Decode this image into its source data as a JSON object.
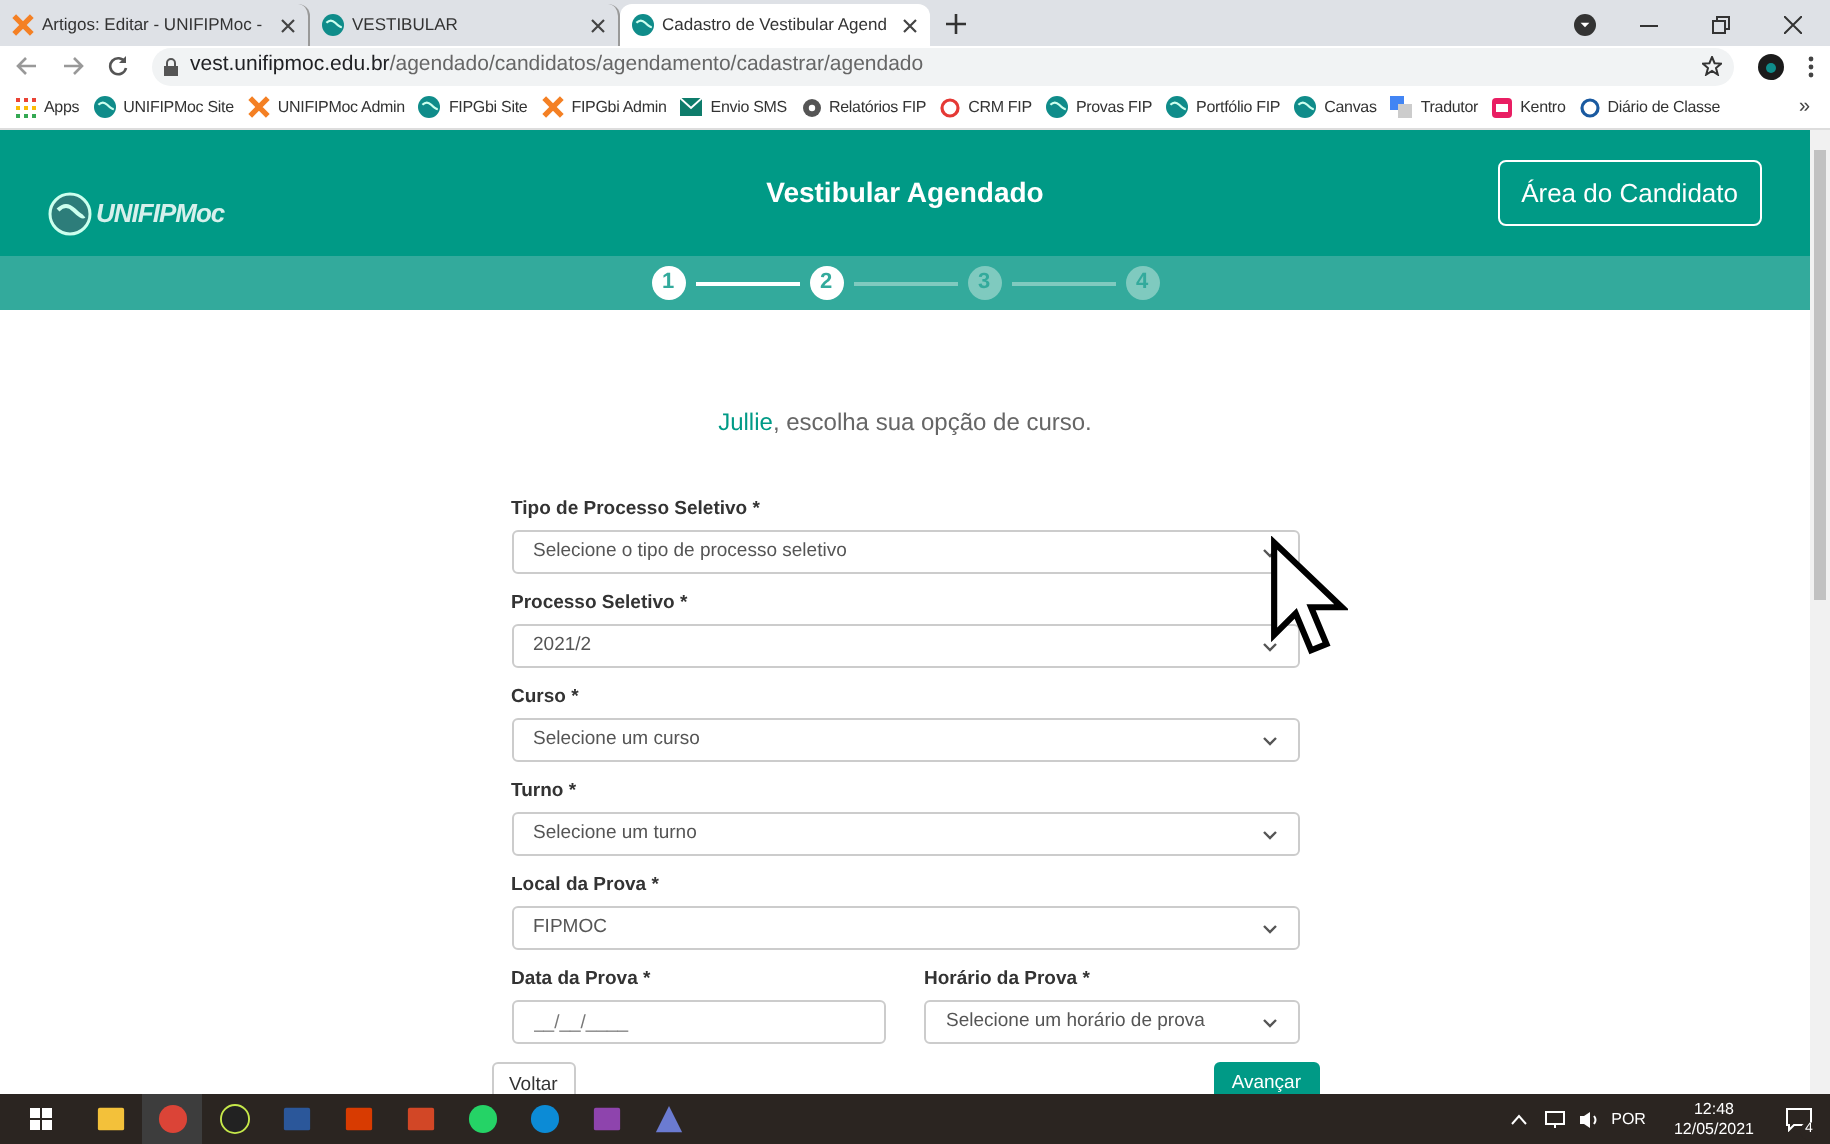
{
  "browser": {
    "tabs": [
      {
        "title": "Artigos: Editar - UNIFIPMoc -",
        "selected": false
      },
      {
        "title": "VESTIBULAR",
        "selected": false
      },
      {
        "title": "Cadastro de Vestibular Agend",
        "selected": true
      }
    ],
    "url_host": "vest.unifipmoc.edu.br",
    "url_path": "/agendado/candidatos/agendamento/cadastrar/agendado",
    "bookmarks": [
      {
        "label": "Apps"
      },
      {
        "label": "UNIFIPMoc Site"
      },
      {
        "label": "UNIFIPMoc Admin"
      },
      {
        "label": "FIPGbi Site"
      },
      {
        "label": "FIPGbi Admin"
      },
      {
        "label": "Envio SMS"
      },
      {
        "label": "Relatórios FIP"
      },
      {
        "label": "CRM FIP"
      },
      {
        "label": "Provas FIP"
      },
      {
        "label": "Portfólio FIP"
      },
      {
        "label": "Canvas"
      },
      {
        "label": "Tradutor"
      },
      {
        "label": "Kentro"
      },
      {
        "label": "Diário de Classe"
      }
    ],
    "more": "»"
  },
  "header": {
    "logo": "UNIFIPMoc",
    "title": "Vestibular Agendado",
    "button": "Área do Candidato"
  },
  "steps": [
    {
      "label": "1",
      "active": true
    },
    {
      "label": "2",
      "active": true
    },
    {
      "label": "3",
      "active": false
    },
    {
      "label": "4",
      "active": false
    }
  ],
  "greeting": {
    "name": "Jullie",
    "text": ", escolha sua opção de curso."
  },
  "form": {
    "rows": [
      [
        {
          "label": "Tipo de Processo Seletivo *",
          "kind": "select",
          "placeholder": "Selecione o tipo de processo seletivo"
        }
      ],
      [
        {
          "label": "Processo Seletivo *",
          "kind": "select",
          "value": "2021/2"
        }
      ],
      [
        {
          "label": "Curso *",
          "kind": "select",
          "placeholder": "Selecione um curso"
        }
      ],
      [
        {
          "label": "Turno *",
          "kind": "select",
          "placeholder": "Selecione um turno"
        }
      ],
      [
        {
          "label": "Local da Prova *",
          "kind": "select",
          "value": "FIPMOC"
        }
      ],
      [
        {
          "label": "Data da Prova *",
          "kind": "input",
          "placeholder": "__/__/____"
        },
        {
          "label": "Horário da Prova *",
          "kind": "select",
          "placeholder": "Selecione um horário de prova"
        }
      ]
    ],
    "back": "Voltar",
    "next": "Avançar"
  },
  "taskbar": {
    "language": "POR",
    "time": "12:48",
    "date": "12/05/2021",
    "notifications": "4"
  }
}
